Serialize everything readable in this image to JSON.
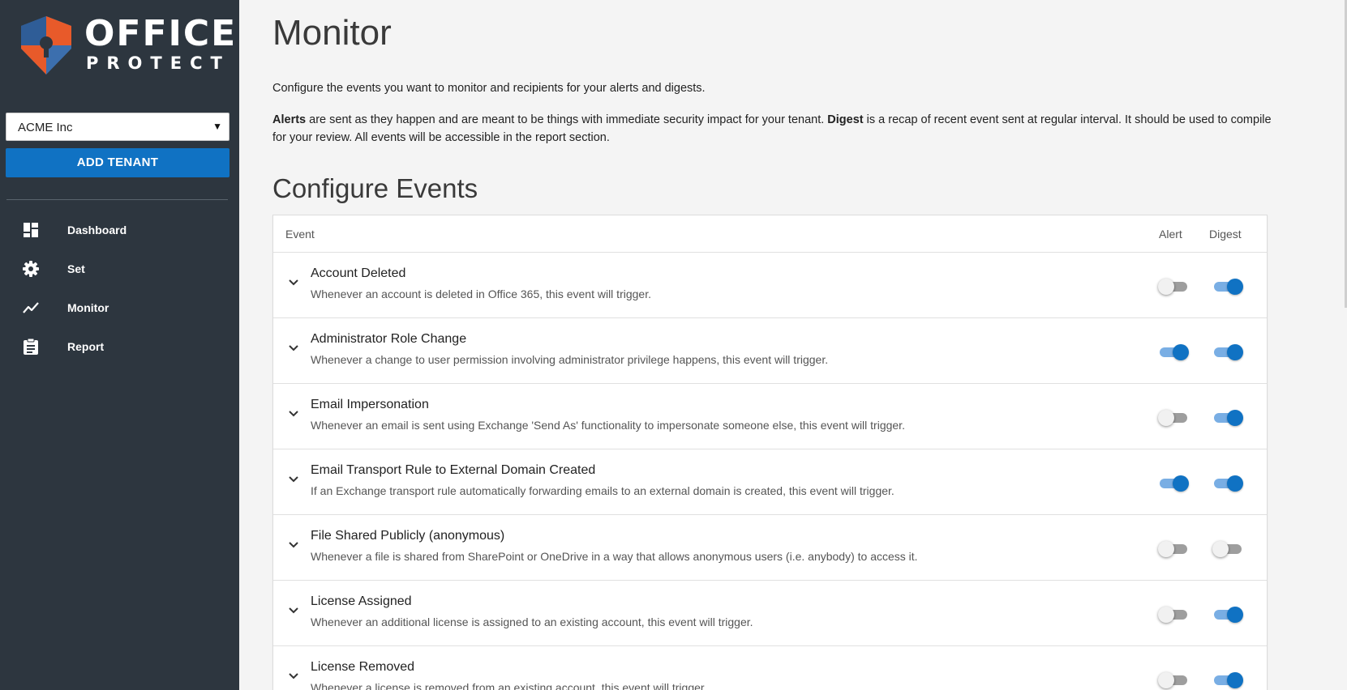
{
  "brand": {
    "line1": "OFFICE",
    "line2": "PROTECT",
    "colors": {
      "blue": "#3c6fae",
      "orange": "#e85a2a"
    }
  },
  "tenant": {
    "selected": "ACME Inc"
  },
  "add_tenant_label": "ADD TENANT",
  "nav": [
    {
      "label": "Dashboard",
      "icon": "dashboard-icon"
    },
    {
      "label": "Set",
      "icon": "gear-icon"
    },
    {
      "label": "Monitor",
      "icon": "trend-line-icon"
    },
    {
      "label": "Report",
      "icon": "clipboard-icon"
    }
  ],
  "page": {
    "title": "Monitor",
    "intro": "Configure the events you want to monitor and recipients for your alerts and digests.",
    "desc_alerts_label": "Alerts",
    "desc_alerts_text": " are sent as they happen and are meant to be things with immediate security impact for your tenant. ",
    "desc_digest_label": "Digest",
    "desc_digest_text": " is a recap of recent event sent at regular interval. It should be used to compile for your review. All events will be accessible in the report section.",
    "section_title": "Configure Events"
  },
  "table": {
    "headers": {
      "event": "Event",
      "alert": "Alert",
      "digest": "Digest"
    },
    "rows": [
      {
        "title": "Account Deleted",
        "desc": "Whenever an account is deleted in Office 365, this event will trigger.",
        "alert": false,
        "digest": true
      },
      {
        "title": "Administrator Role Change",
        "desc": "Whenever a change to user permission involving administrator privilege happens, this event will trigger.",
        "alert": true,
        "digest": true
      },
      {
        "title": "Email Impersonation",
        "desc": "Whenever an email is sent using Exchange 'Send As' functionality to impersonate someone else, this event will trigger.",
        "alert": false,
        "digest": true
      },
      {
        "title": "Email Transport Rule to External Domain Created",
        "desc": "If an Exchange transport rule automatically forwarding emails to an external domain is created, this event will trigger.",
        "alert": true,
        "digest": true
      },
      {
        "title": "File Shared Publicly (anonymous)",
        "desc": "Whenever a file is shared from SharePoint or OneDrive in a way that allows anonymous users (i.e. anybody) to access it.",
        "alert": false,
        "digest": false
      },
      {
        "title": "License Assigned",
        "desc": "Whenever an additional license is assigned to an existing account, this event will trigger.",
        "alert": false,
        "digest": true
      },
      {
        "title": "License Removed",
        "desc": "Whenever a license is removed from an existing account, this event will trigger.",
        "alert": false,
        "digest": true
      }
    ]
  }
}
